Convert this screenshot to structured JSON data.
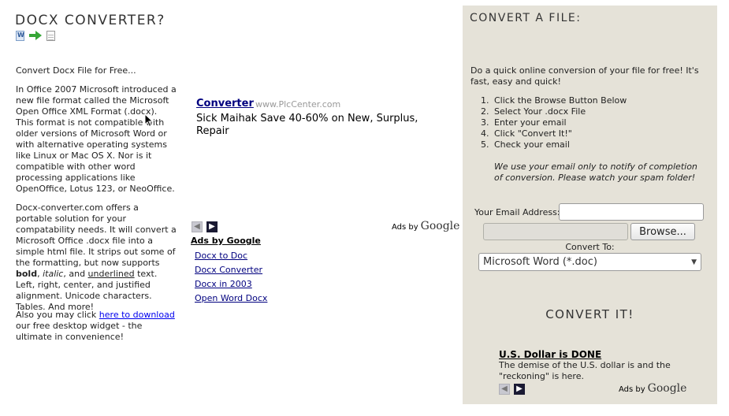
{
  "site": {
    "title": "DOCX CONVERTER?"
  },
  "left": {
    "tagline": "Convert Docx File for Free...",
    "para1": "In Office 2007 Microsoft introduced a new file format called the Microsoft Open Office XML Format (.docx). This format is not compatible with older versions of Microsoft Word or with alternative operating systems like Linux or Mac OS X. Nor is it compatible with other word processing applications like OpenOffice, Lotus 123, or NeoOffice.",
    "para2_start": "Docx-converter.com offers a portable solution for your compatability needs. It will convert a Microsoft Office .docx file into a simple html file. It strips out some of the formatting, but now supports ",
    "para2_bold": "bold",
    "para2_sep1": ", ",
    "para2_italic": "italic",
    "para2_sep2": ", and ",
    "para2_underlined": "underlined",
    "para2_end": " text. Left, right, center, and justified alignment. Unicode characters. Tables. And more!",
    "para3_start": "Also you may click ",
    "para3_link": "here to download",
    "para3_end": " our free desktop widget - the ultimate in convenience!"
  },
  "ad_main": {
    "title": "Converter",
    "url": "www.PlcCenter.com",
    "body": "Sick Maihak Save 40-60% on New, Surplus, Repair"
  },
  "ads_by": "Ads by",
  "google": "Google",
  "ad_links": {
    "label": "Ads by Google",
    "items": [
      "Docx to Doc",
      "Docx Converter",
      "Docx in 2003",
      "Open Word Docx"
    ]
  },
  "panel": {
    "title": "CONVERT A FILE:",
    "intro": "Do a quick online conversion of your file for free! It's fast, easy and quick!",
    "steps": [
      "Click the Browse Button Below",
      "Select Your .docx File",
      "Enter your email",
      "Click \"Convert It!\"",
      "Check your email"
    ],
    "step_numbers": [
      "1.",
      "2.",
      "3.",
      "4.",
      "5."
    ],
    "email_note": "We use your email only to notify of completion of conversion. Please watch your spam folder!",
    "email_label": "Your Email Address:",
    "email_value": "",
    "browse_label": "Browse...",
    "convert_to_label": "Convert To:",
    "format_selected": "Microsoft Word (*.doc)",
    "convert_button": "CONVERT IT!"
  },
  "ad_panel": {
    "title": "U.S. Dollar is DONE",
    "body": "The demise of the U.S. dollar is and the \"reckoning\" is here."
  },
  "icons": {
    "prev": "chevron-left-icon",
    "next": "chevron-right-icon",
    "caret": "chevron-down-icon"
  }
}
